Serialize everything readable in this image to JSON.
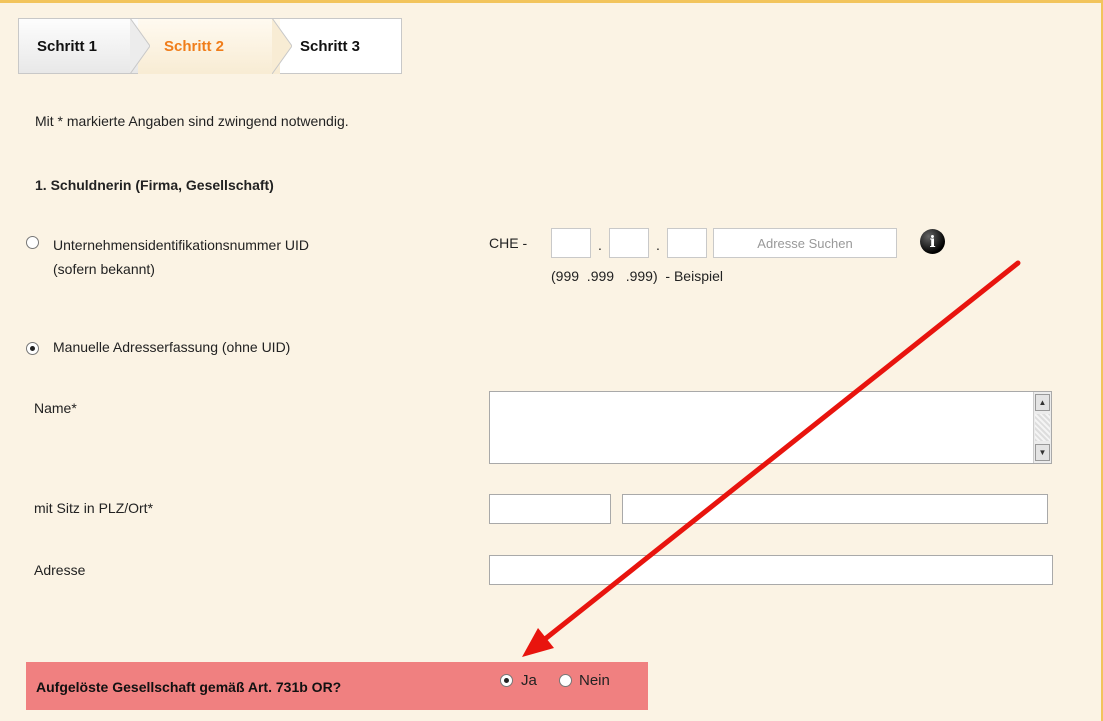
{
  "tabs": [
    {
      "label": "Schritt 1",
      "active": false
    },
    {
      "label": "Schritt 2",
      "active": true
    },
    {
      "label": "Schritt 3",
      "active": false
    }
  ],
  "required_note": "Mit * markierte Angaben sind zwingend notwendig.",
  "section_title": "1. Schuldnerin (Firma, Gesellschaft)",
  "uid": {
    "label_line1": "Unternehmensidentifikationsnummer UID",
    "label_line2": "(sofern bekannt)",
    "prefix": "CHE -",
    "separator": ".",
    "search_button": "Adresse Suchen",
    "example": "(999  .999   .999)  - Beispiel",
    "selected": false
  },
  "manual": {
    "label": "Manuelle Adresserfassung (ohne UID)",
    "selected": true
  },
  "fields": {
    "name_label": "Name*",
    "plz_label": "mit Sitz in PLZ/Ort*",
    "address_label": "Adresse"
  },
  "dissolved": {
    "label": "Aufgelöste Gesellschaft gemäß Art. 731b OR?",
    "options": [
      {
        "label": "Ja",
        "selected": true
      },
      {
        "label": "Nein",
        "selected": false
      }
    ]
  },
  "colors": {
    "accent_tab": "#f07d1a",
    "highlight_bar": "#f08080",
    "page_bg": "#fbf3e4",
    "frame_border": "#f2c45c",
    "arrow": "#e8140e"
  },
  "icons": {
    "info": "info-icon"
  }
}
